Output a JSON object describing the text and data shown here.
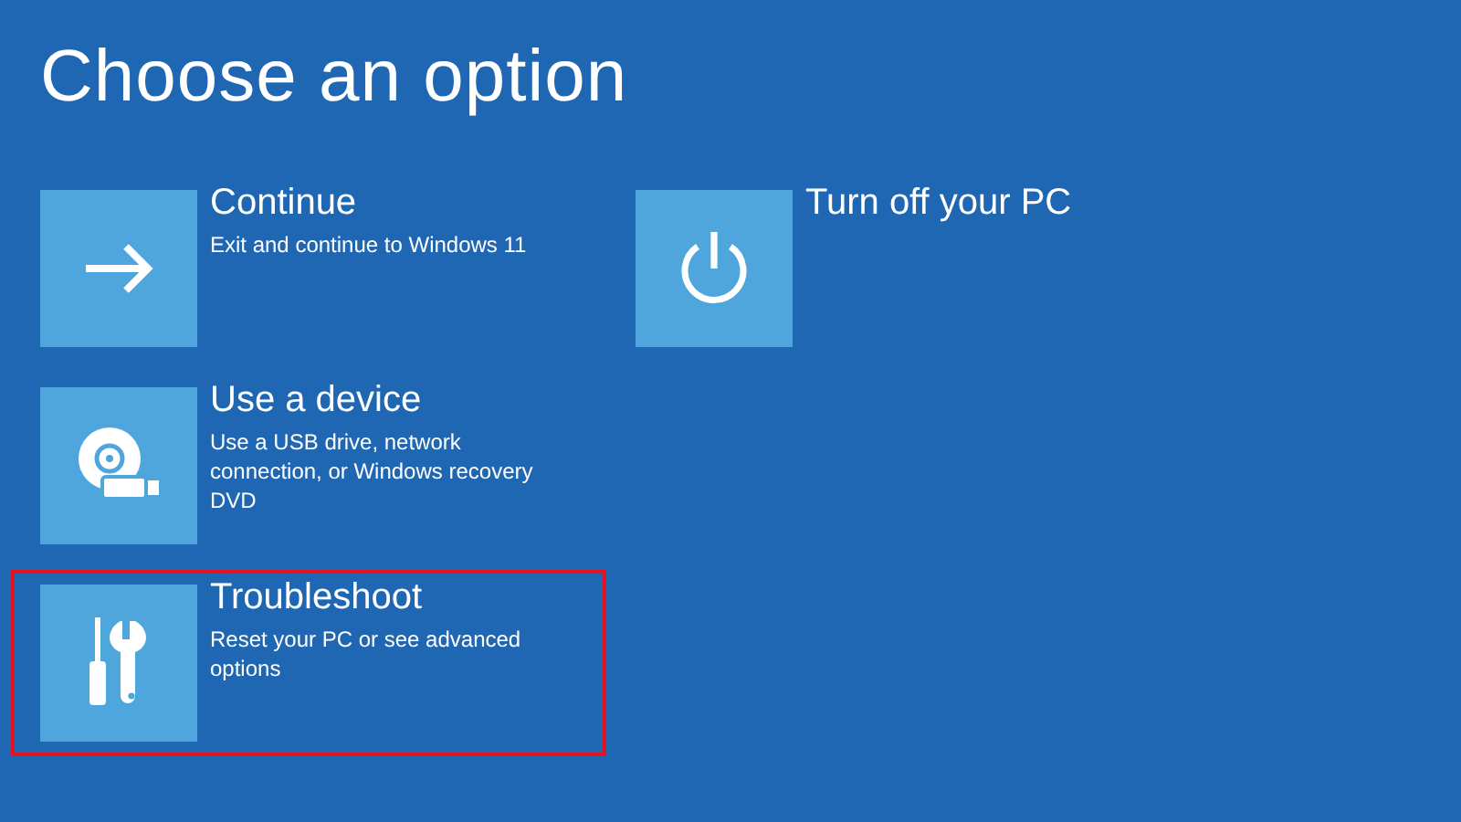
{
  "title": "Choose an option",
  "columns": [
    [
      {
        "kind": "arrow",
        "title": "Continue",
        "description": "Exit and continue to Windows 11",
        "selected": false
      },
      {
        "kind": "device",
        "title": "Use a device",
        "description": "Use a USB drive, network connection, or Windows recovery DVD",
        "selected": false
      },
      {
        "kind": "tools",
        "title": "Troubleshoot",
        "description": "Reset your PC or see advanced options",
        "selected": true
      }
    ],
    [
      {
        "kind": "power",
        "title": "Turn off your PC",
        "selected": false
      }
    ]
  ]
}
